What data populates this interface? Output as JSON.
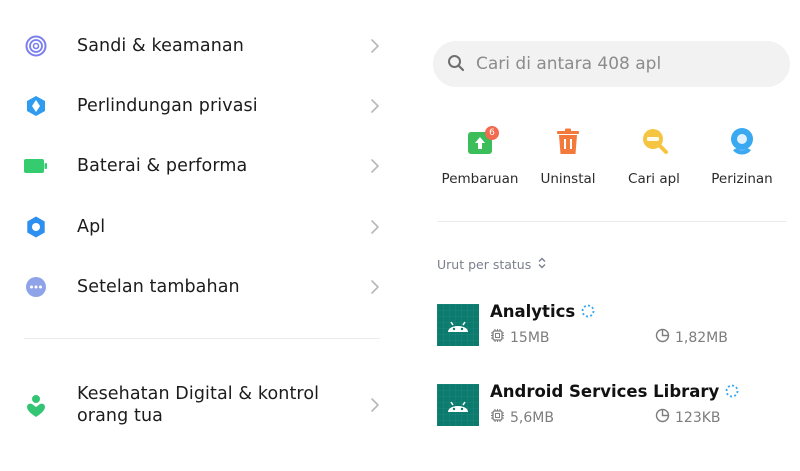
{
  "settings_list": {
    "items": [
      {
        "label": "Sandi & keamanan",
        "icon": "fingerprint-icon"
      },
      {
        "label": "Perlindungan privasi",
        "icon": "privacy-shield-icon"
      },
      {
        "label": "Baterai & performa",
        "icon": "battery-icon"
      },
      {
        "label": "Apl",
        "icon": "gear-icon"
      },
      {
        "label": "Setelan tambahan",
        "icon": "more-dots-icon"
      }
    ],
    "digital_wellbeing": {
      "label_line1": "Kesehatan Digital & kontrol",
      "label_line2": "orang tua",
      "icon": "wellbeing-person-icon"
    }
  },
  "apps_panel": {
    "search": {
      "placeholder": "Cari di antara 408 apl"
    },
    "quick_actions": [
      {
        "label": "Pembaruan",
        "icon": "update-arrow-icon",
        "badge": "6"
      },
      {
        "label": "Uninstal",
        "icon": "trash-icon"
      },
      {
        "label": "Cari apl",
        "icon": "find-apps-icon"
      },
      {
        "label": "Perizinan",
        "icon": "permissions-icon"
      }
    ],
    "sort_label": "Urut per status",
    "apps": [
      {
        "name": "Analytics",
        "app_size": "15MB",
        "cache_size": "1,82MB"
      },
      {
        "name": "Android Services Library",
        "app_size": "5,6MB",
        "cache_size": "123KB"
      }
    ]
  },
  "colors": {
    "fingerprint": "#7a7ff0",
    "privacy": "#2f9cf0",
    "battery": "#35cc6f",
    "gear": "#2d8ff0",
    "more": "#8fa3e8",
    "wellbeing": "#34c574",
    "update": "#3bbd59",
    "badge": "#f26a4f",
    "trash": "#f47a3c",
    "find": "#f5c542",
    "permissions": "#3aa9f2",
    "app_icon_bg": "#0d7a6e",
    "spinner": "#36a5ee"
  }
}
